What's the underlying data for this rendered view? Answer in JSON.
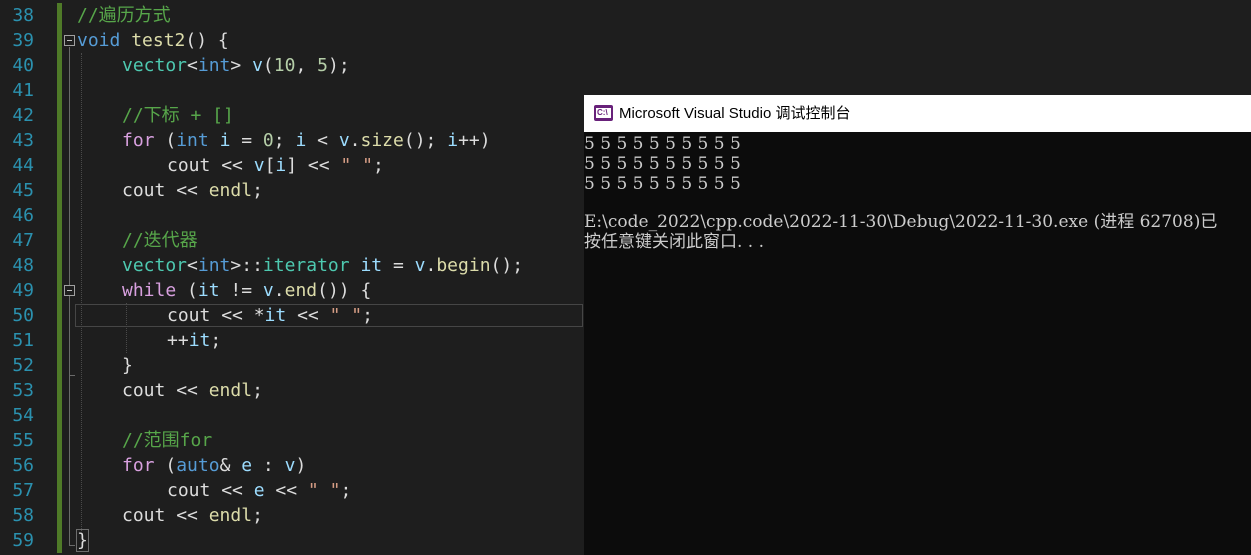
{
  "editor": {
    "line_numbers": [
      "38",
      "39",
      "40",
      "41",
      "42",
      "43",
      "44",
      "45",
      "46",
      "47",
      "48",
      "49",
      "50",
      "51",
      "52",
      "53",
      "54",
      "55",
      "56",
      "57",
      "58",
      "59"
    ],
    "code": {
      "l38_comment": "//遍历方式",
      "l39_void": "void",
      "l39_name": "test2",
      "l39_rest": "() {",
      "l40_type": "vector",
      "l40_lt": "<",
      "l40_int": "int",
      "l40_rest1": "> ",
      "l40_var": "v",
      "l40_rest2": "(",
      "l40_n1": "10",
      "l40_comma": ", ",
      "l40_n2": "5",
      "l40_end": ");",
      "l42_comment": "//下标 + []",
      "l43_for": "for",
      "l43_p": " (",
      "l43_int": "int",
      "l43_sp": " ",
      "l43_i": "i",
      "l43_eq": " = ",
      "l43_zero": "0",
      "l43_semi": "; ",
      "l43_i2": "i",
      "l43_lt": " < ",
      "l43_v": "v",
      "l43_dot": ".",
      "l43_size": "size",
      "l43_call": "(); ",
      "l43_i3": "i",
      "l43_end": "++)",
      "l44_cout": "cout",
      "l44_op": " << ",
      "l44_v": "v",
      "l44_br": "[",
      "l44_i": "i",
      "l44_br2": "] << ",
      "l44_str": "\" \"",
      "l44_end": ";",
      "l45_cout": "cout",
      "l45_op": " << ",
      "l45_endl": "endl",
      "l45_end": ";",
      "l47_comment": "//迭代器",
      "l48_type": "vector",
      "l48_lt": "<",
      "l48_int": "int",
      "l48_scope": ">::",
      "l48_iter": "iterator",
      "l48_sp": " ",
      "l48_it": "it",
      "l48_eq": " = ",
      "l48_v": "v",
      "l48_dot": ".",
      "l48_begin": "begin",
      "l48_end": "();",
      "l49_while": "while",
      "l49_p": " (",
      "l49_it": "it",
      "l49_ne": " != ",
      "l49_v": "v",
      "l49_dot": ".",
      "l49_endfn": "end",
      "l49_rest": "()) {",
      "l50_cout": "cout",
      "l50_op": " << *",
      "l50_it": "it",
      "l50_op2": " << ",
      "l50_str": "\" \"",
      "l50_end": ";",
      "l51_pp": "++",
      "l51_it": "it",
      "l51_end": ";",
      "l52_brace": "}",
      "l53_cout": "cout",
      "l53_op": " << ",
      "l53_endl": "endl",
      "l53_end": ";",
      "l55_comment": "//范围for",
      "l56_for": "for",
      "l56_p": " (",
      "l56_auto": "auto",
      "l56_amp": "& ",
      "l56_e": "e",
      "l56_colon": " : ",
      "l56_v": "v",
      "l56_end": ")",
      "l57_cout": "cout",
      "l57_op": " << ",
      "l57_e": "e",
      "l57_op2": " << ",
      "l57_str": "\" \"",
      "l57_end": ";",
      "l58_cout": "cout",
      "l58_op": " << ",
      "l58_endl": "endl",
      "l58_end": ";",
      "l59_brace": "}"
    },
    "colors": {
      "background": "#1e1e1e",
      "line_number": "#2b91af",
      "keyword": "#569cd6",
      "comment": "#57a64a",
      "function": "#dcdcaa",
      "type": "#4ec9b0",
      "variable": "#9cdcfe",
      "number": "#b5cea8",
      "string": "#d69d85",
      "control": "#d8a0df",
      "change_bar": "#4f7a28"
    }
  },
  "console": {
    "icon": "visual-studio-icon",
    "icon_text": "C:\\",
    "title": "Microsoft Visual Studio 调试控制台",
    "output_lines": [
      "5 5 5 5 5 5 5 5 5 5",
      "5 5 5 5 5 5 5 5 5 5",
      "5 5 5 5 5 5 5 5 5 5",
      "",
      "E:\\code_2022\\cpp.code\\2022-11-30\\Debug\\2022-11-30.exe (进程 62708)已",
      "按任意键关闭此窗口. . ."
    ],
    "colors": {
      "titlebar": "#ffffff",
      "background": "#0c0c0c",
      "text": "#cccccc"
    }
  }
}
